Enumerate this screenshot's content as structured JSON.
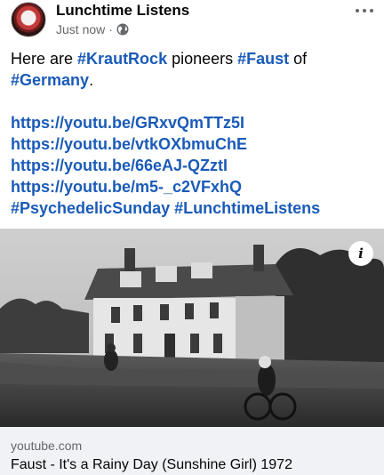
{
  "post": {
    "page_name": "Lunchtime Listens",
    "timestamp": "Just now",
    "separator": "·",
    "privacy_icon": "globe-icon",
    "menu_icon": "more-options-icon"
  },
  "text": {
    "intro_1": "Here are ",
    "tag_krautrock": "#KrautRock",
    "intro_2": " pioneers ",
    "tag_faust": "#Faust",
    "intro_3": " of",
    "tag_germany": "#Germany",
    "intro_4": ".",
    "links": [
      "https://youtu.be/GRxvQmTTz5I",
      "https://youtu.be/vtkOXbmuChE",
      "https://youtu.be/66eAJ-QZztI",
      "https://youtu.be/m5-_c2VFxhQ"
    ],
    "tag_psychedelic": "#PsychedelicSunday",
    "tag_space": " ",
    "tag_lunchtime": "#LunchtimeListens"
  },
  "video": {
    "info_label": "i"
  },
  "preview": {
    "domain": "youtube.com",
    "title": "Faust - It's a Rainy Day (Sunshine Girl) 1972"
  },
  "colors": {
    "link": "#1a5bb8",
    "secondary_text": "#65676b",
    "preview_bg": "#f0f2f5"
  }
}
